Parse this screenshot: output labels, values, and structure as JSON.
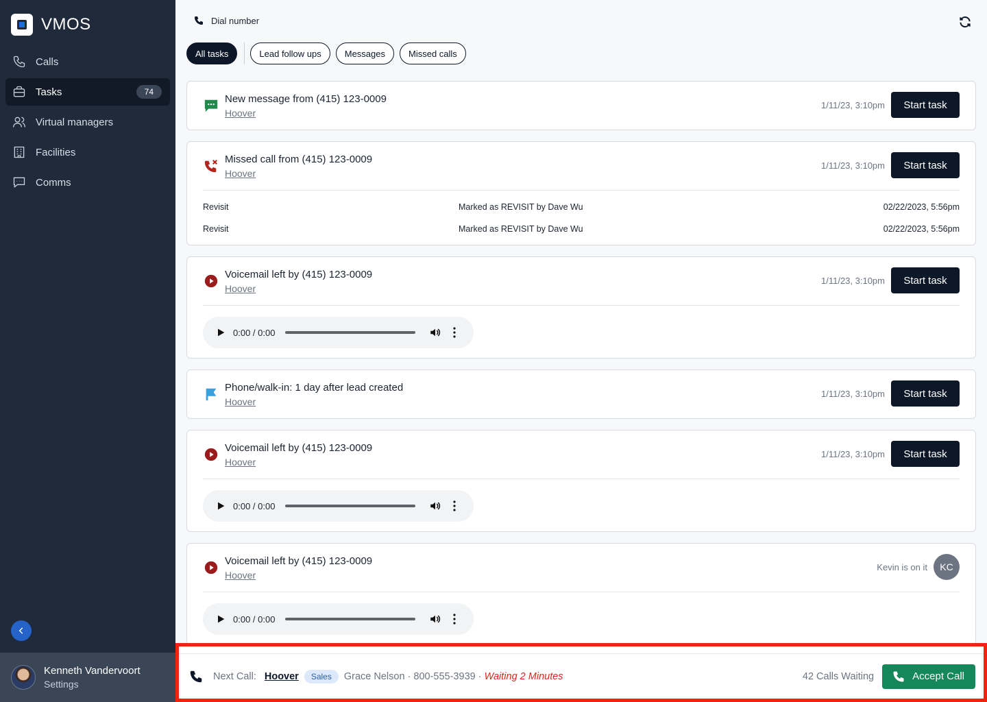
{
  "app": {
    "name": "VMOS"
  },
  "sidebar": {
    "items": [
      {
        "label": "Calls",
        "icon": "phone-icon"
      },
      {
        "label": "Tasks",
        "icon": "briefcase-icon",
        "badge": "74",
        "active": true
      },
      {
        "label": "Virtual managers",
        "icon": "users-icon"
      },
      {
        "label": "Facilities",
        "icon": "building-icon"
      },
      {
        "label": "Comms",
        "icon": "chat-icon"
      }
    ],
    "user": {
      "name": "Kenneth Vandervoort",
      "settings_label": "Settings"
    }
  },
  "header": {
    "dial_label": "Dial number"
  },
  "tabs": [
    "All tasks",
    "Lead follow ups",
    "Messages",
    "Missed calls"
  ],
  "tasks": [
    {
      "icon": "message-icon",
      "title": "New message from (415) 123-0009",
      "link": "Hoover",
      "time": "1/11/23, 3:10pm",
      "button": "Start task"
    },
    {
      "icon": "missed-call-icon",
      "title": "Missed call from (415) 123-0009",
      "link": "Hoover",
      "time": "1/11/23, 3:10pm",
      "button": "Start task",
      "log": [
        {
          "status": "Revisit",
          "note": "Marked as REVISIT by Dave Wu",
          "date": "02/22/2023, 5:56pm"
        },
        {
          "status": "Revisit",
          "note": "Marked as REVISIT by Dave Wu",
          "date": "02/22/2023, 5:56pm"
        }
      ]
    },
    {
      "icon": "voicemail-icon",
      "title": "Voicemail left by (415) 123-0009",
      "link": "Hoover",
      "time": "1/11/23, 3:10pm",
      "button": "Start task",
      "audio_time": "0:00 / 0:00"
    },
    {
      "icon": "flag-icon",
      "title": "Phone/walk-in: 1 day after lead created",
      "link": "Hoover",
      "time": "1/11/23, 3:10pm",
      "button": "Start task"
    },
    {
      "icon": "voicemail-icon",
      "title": "Voicemail left by (415) 123-0009",
      "link": "Hoover",
      "time": "1/11/23, 3:10pm",
      "button": "Start task",
      "audio_time": "0:00 / 0:00"
    },
    {
      "icon": "voicemail-icon",
      "title": "Voicemail left by (415) 123-0009",
      "link": "Hoover",
      "on_it": "Kevin is on it",
      "initials": "KC",
      "audio_time": "0:00 / 0:00"
    }
  ],
  "callbar": {
    "label": "Next Call:",
    "name": "Hoover",
    "tag": "Sales",
    "detail": "Grace Nelson · 800-555-3939 ·",
    "waiting": "Waiting 2 Minutes",
    "count": "42 Calls Waiting",
    "accept": "Accept Call"
  },
  "colors": {
    "accent_dark": "#0c1728",
    "sidebar": "#1f2a3a",
    "accept": "#15875a",
    "highlight_border": "#f0230f",
    "waiting": "#d9261c"
  }
}
